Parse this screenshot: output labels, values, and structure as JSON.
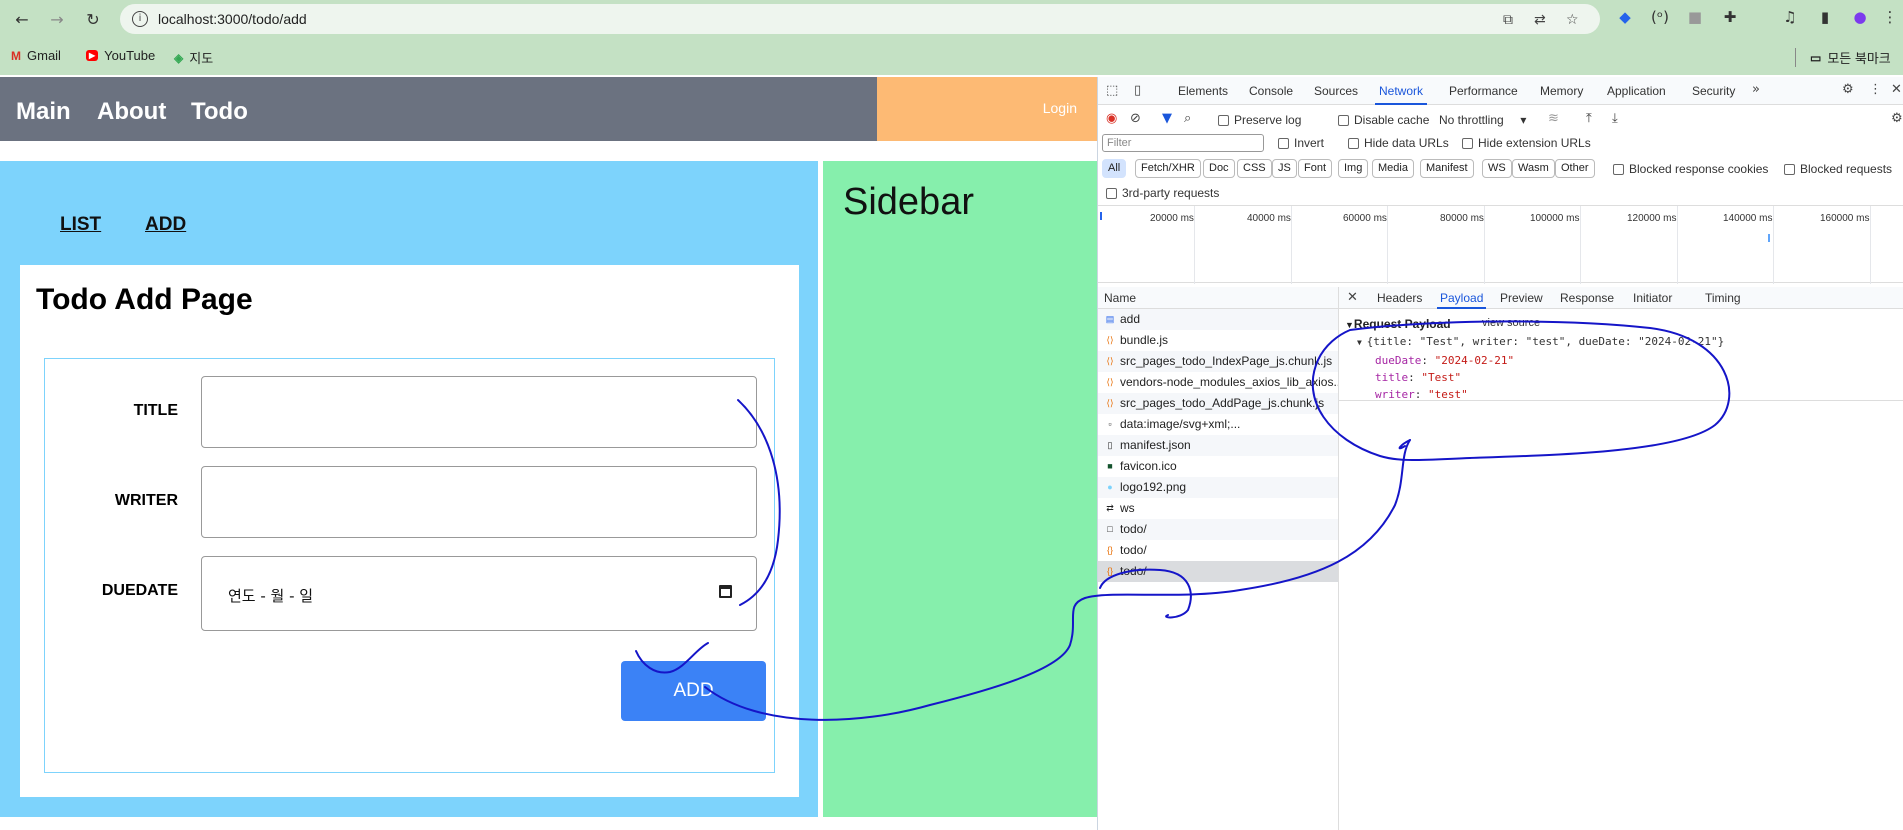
{
  "browser": {
    "url": "localhost:3000/todo/add",
    "bookmarks": [
      {
        "label": "Gmail"
      },
      {
        "label": "YouTube"
      },
      {
        "label": "지도"
      }
    ],
    "bookmark_folder": "모든 북마크"
  },
  "app": {
    "nav": {
      "main": "Main",
      "about": "About",
      "todo": "Todo"
    },
    "login": "Login",
    "subnav": {
      "list": "LIST",
      "add": "ADD"
    },
    "page_title": "Todo Add Page",
    "form": {
      "title_label": "TITLE",
      "writer_label": "WRITER",
      "duedate_label": "DUEDATE",
      "duedate_placeholder": "연도 - 월 - 일",
      "add_label": "ADD"
    },
    "sidebar_title": "Sidebar"
  },
  "devtools": {
    "tabs": [
      "Elements",
      "Console",
      "Sources",
      "Network",
      "Performance",
      "Memory",
      "Application",
      "Security"
    ],
    "active_tab": "Network",
    "toolbar": {
      "preserve_log": "Preserve log",
      "disable_cache": "Disable cache",
      "throttling": "No throttling"
    },
    "filter_placeholder": "Filter",
    "invert": "Invert",
    "hide_data_urls": "Hide data URLs",
    "hide_extension_urls": "Hide extension URLs",
    "type_filters": [
      "All",
      "Fetch/XHR",
      "Doc",
      "CSS",
      "JS",
      "Font",
      "Img",
      "Media",
      "Manifest",
      "WS",
      "Wasm",
      "Other"
    ],
    "blocked_cookies": "Blocked response cookies",
    "blocked_requests": "Blocked requests",
    "third_party": "3rd-party requests",
    "timeline_ticks": [
      "20000 ms",
      "40000 ms",
      "60000 ms",
      "80000 ms",
      "100000 ms",
      "120000 ms",
      "140000 ms",
      "160000 ms"
    ],
    "name_header": "Name",
    "requests": [
      "add",
      "bundle.js",
      "src_pages_todo_IndexPage_js.chunk.js",
      "vendors-node_modules_axios_lib_axios...",
      "src_pages_todo_AddPage_js.chunk.js",
      "data:image/svg+xml;...",
      "manifest.json",
      "favicon.ico",
      "logo192.png",
      "ws",
      "todo/",
      "todo/",
      "todo/"
    ],
    "detail_tabs": [
      "Headers",
      "Payload",
      "Preview",
      "Response",
      "Initiator",
      "Timing"
    ],
    "active_detail_tab": "Payload",
    "payload": {
      "section": "Request Payload",
      "view_source": "view source",
      "summary": "{title: \"Test\", writer: \"test\", dueDate: \"2024-02-21\"}",
      "fields": [
        {
          "key": "dueDate",
          "value": "\"2024-02-21\""
        },
        {
          "key": "title",
          "value": "\"Test\""
        },
        {
          "key": "writer",
          "value": "\"test\""
        }
      ]
    }
  },
  "colors": {
    "header": "#6b7280",
    "login_bg": "#fdba74",
    "content_bg": "#7dd3fc",
    "sidebar_bg": "#86efac",
    "button": "#3b82f6",
    "annotation": "#1515c8"
  }
}
